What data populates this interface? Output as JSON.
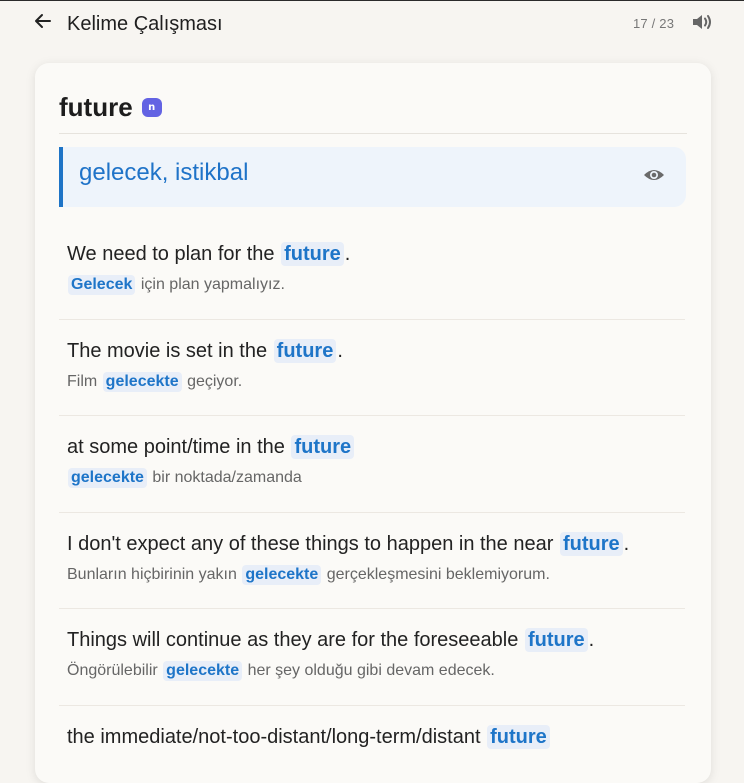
{
  "header": {
    "title": "Kelime Çalışması",
    "counter": "17 / 23"
  },
  "entry": {
    "word": "future",
    "pos_badge": "n",
    "meaning": "gelecek, istikbal"
  },
  "examples": [
    {
      "en_before": "We need to plan for the",
      "en_highlight": "future",
      "en_after": ".",
      "tr_before": "",
      "tr_highlight": "Gelecek",
      "tr_after": "için plan yapmalıyız."
    },
    {
      "en_before": "The movie is set in the",
      "en_highlight": "future",
      "en_after": ".",
      "tr_before": "Film",
      "tr_highlight": "gelecekte",
      "tr_after": "geçiyor."
    },
    {
      "en_before": "at some point/time in the",
      "en_highlight": "future",
      "en_after": "",
      "tr_before": "",
      "tr_highlight": "gelecekte",
      "tr_after": "bir noktada/zamanda"
    },
    {
      "en_before": "I don't expect any of these things to happen in the near",
      "en_highlight": "future",
      "en_after": ".",
      "tr_before": "Bunların hiçbirinin yakın",
      "tr_highlight": "gelecekte",
      "tr_after": "gerçekleşmesini beklemiyorum."
    },
    {
      "en_before": "Things will continue as they are for the foreseeable",
      "en_highlight": "future",
      "en_after": ".",
      "tr_before": "Öngörülebilir",
      "tr_highlight": "gelecekte",
      "tr_after": "her şey olduğu gibi devam edecek."
    },
    {
      "en_before": "the immediate/not-too-distant/long-term/distant",
      "en_highlight": "future",
      "en_after": "",
      "tr_before": "",
      "tr_highlight": "",
      "tr_after": ""
    }
  ],
  "icons": {
    "back": "arrow-left-icon",
    "sound": "speaker-icon",
    "reveal": "eye-icon"
  },
  "colors": {
    "accent": "#1e74c6",
    "badge": "#6363e3",
    "highlight_bg": "#e8eef8",
    "meaning_bg": "#eef4fb"
  }
}
